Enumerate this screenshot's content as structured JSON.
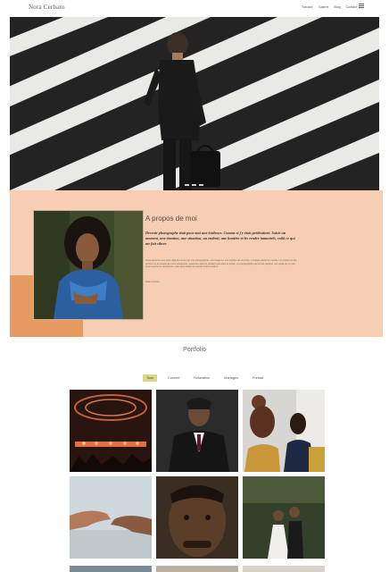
{
  "header": {
    "logo": "Nora Cerbaro",
    "nav": [
      "Travaux",
      "Galerie",
      "Blog",
      "Contact"
    ]
  },
  "hero": {
    "slides": 3
  },
  "about": {
    "title": "A propos de moi",
    "quote": "Devenir photographe était pour moi une évidence. Comme si j'y étais prédestinée. Saisir un moment, une émotion, une situation, un endroit, une lumière et les rendre immortels, voilà ce qui me fait vibrer.",
    "body": "Nous pensons tous avoir déjà été émus par une photographie, une image en une fraction de seconde, à chaque partie du monde. Un endroit où les photos ont le pouvoir de nous transporter, aussi bien dans le présent que dans le passé. La photographie permet de capturer une partie de ce que nous voyons ou ressentons, sans pour autant en perdre toute la valeur.",
    "sign": "Nora Cerbaro"
  },
  "portfolio": {
    "title": "Portfolio",
    "filters": [
      "Tous",
      "Concert",
      "Relaxation",
      "Mariages",
      "Portrait"
    ],
    "active_filter": "Tous"
  },
  "colors": {
    "about_bg": "#f5ceb3",
    "about_accent": "#e89a63",
    "filter_active": "#d9d88a"
  }
}
